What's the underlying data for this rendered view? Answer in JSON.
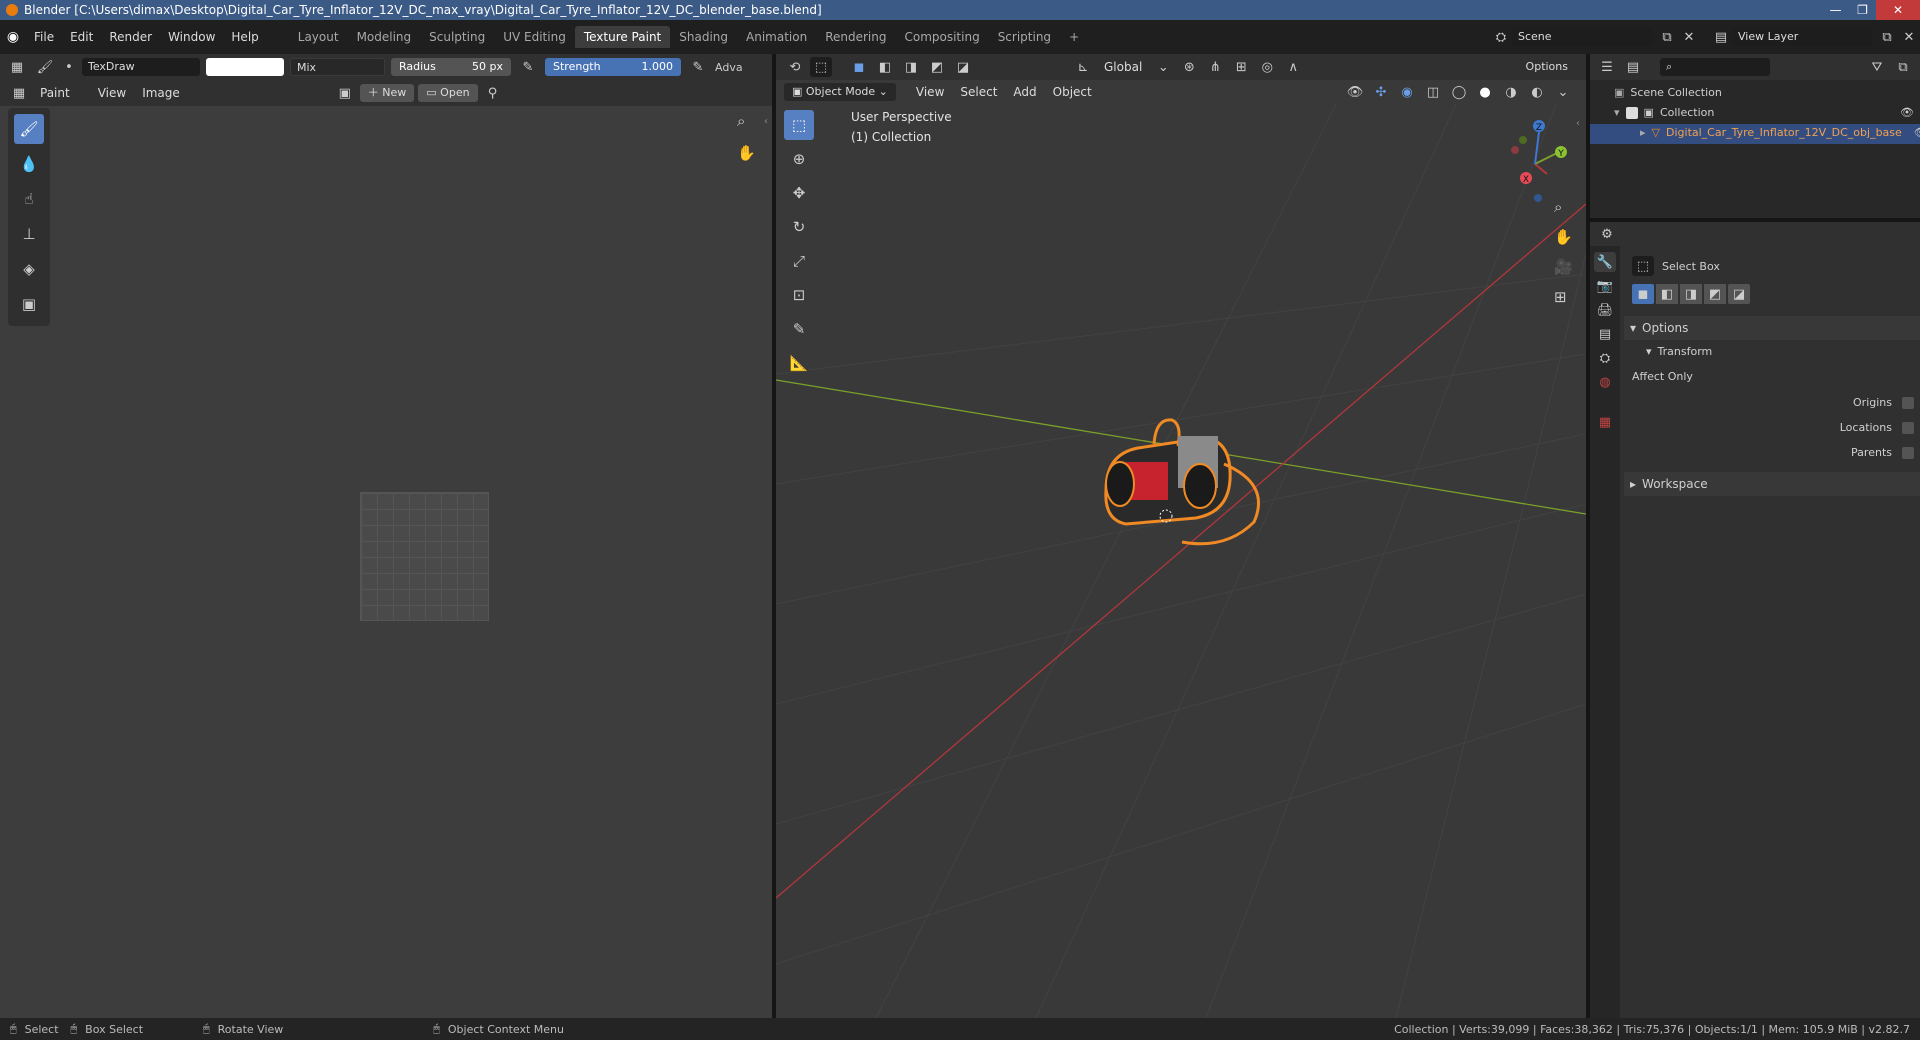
{
  "window": {
    "title": "Blender [C:\\Users\\dimax\\Desktop\\Digital_Car_Tyre_Inflator_12V_DC_max_vray\\Digital_Car_Tyre_Inflator_12V_DC_blender_base.blend]"
  },
  "menubar": {
    "items": [
      "File",
      "Edit",
      "Render",
      "Window",
      "Help"
    ],
    "workspaces": [
      "Layout",
      "Modeling",
      "Sculpting",
      "UV Editing",
      "Texture Paint",
      "Shading",
      "Animation",
      "Rendering",
      "Compositing",
      "Scripting"
    ],
    "add_symbol": "+",
    "scene_label": "Scene",
    "view_layer_label": "View Layer"
  },
  "image_editor": {
    "brush_name": "TexDraw",
    "blend_mode": "Mix",
    "radius_label": "Radius",
    "radius_value": "50 px",
    "strength_label": "Strength",
    "strength_value": "1.000",
    "adv_label": "Adva",
    "mode_label": "Paint",
    "menus": [
      "View",
      "Image"
    ],
    "new_label": "New",
    "open_label": "Open"
  },
  "viewport": {
    "transform_orientation": "Global",
    "options_label": "Options",
    "mode": "Object Mode",
    "menus": [
      "View",
      "Select",
      "Add",
      "Object"
    ],
    "overlay_text_1": "User Perspective",
    "overlay_text_2": "(1) Collection",
    "gizmo_labels": {
      "x": "X",
      "y": "Y",
      "z": "Z"
    }
  },
  "outliner": {
    "root": "Scene Collection",
    "collection": "Collection",
    "object": "Digital_Car_Tyre_Inflator_12V_DC_obj_base"
  },
  "properties": {
    "tool_name": "Select Box",
    "options_label": "Options",
    "transform_label": "Transform",
    "affect_only_label": "Affect Only",
    "checkboxes": [
      "Origins",
      "Locations",
      "Parents"
    ],
    "workspace_label": "Workspace"
  },
  "statusbar": {
    "select": "Select",
    "box_select": "Box Select",
    "rotate_view": "Rotate View",
    "context_menu": "Object Context Menu",
    "stats": "Collection | Verts:39,099 | Faces:38,362 | Tris:75,376 | Objects:1/1 | Mem: 105.9 MiB | v2.82.7"
  },
  "colors": {
    "accent": "#4772b3",
    "selection_orange": "#f08a24",
    "x_axis": "#b3363c",
    "y_axis": "#7ba02a"
  }
}
